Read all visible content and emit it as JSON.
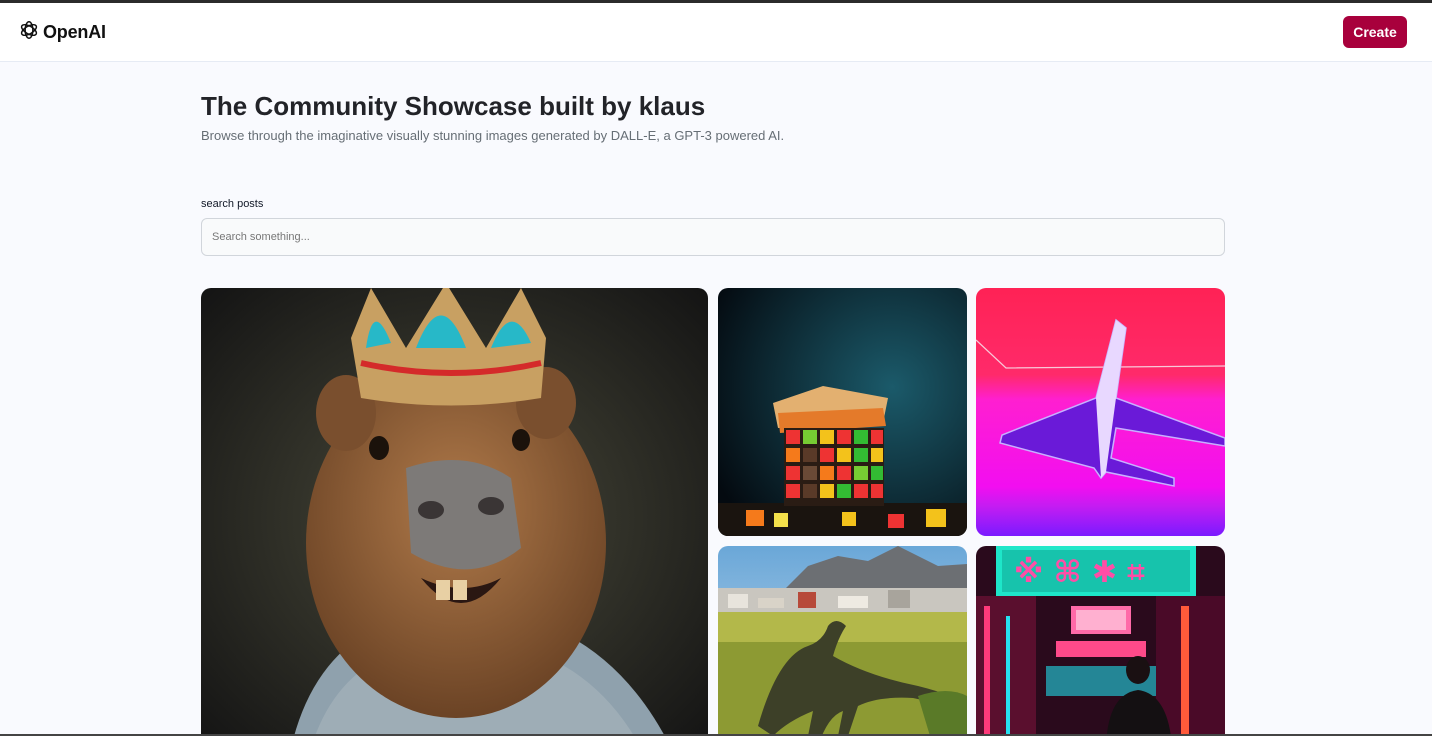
{
  "header": {
    "logo_text": "OpenAI",
    "logo_icon": "openai-logo-icon",
    "create_label": "Create",
    "accent_color": "#a8003c"
  },
  "main": {
    "title": "The Community Showcase built by klaus",
    "subtitle": "Browse through the imaginative visually stunning images generated by DALL-E, a GPT-3 powered AI."
  },
  "search": {
    "label": "search posts",
    "placeholder": "Search something...",
    "value": ""
  },
  "gallery": {
    "cards": [
      {
        "name": "capybara-king-image"
      },
      {
        "name": "rubiks-sandwich-image"
      },
      {
        "name": "synthwave-jet-image"
      },
      {
        "name": "dinosaur-city-image"
      },
      {
        "name": "neon-street-image"
      }
    ]
  }
}
